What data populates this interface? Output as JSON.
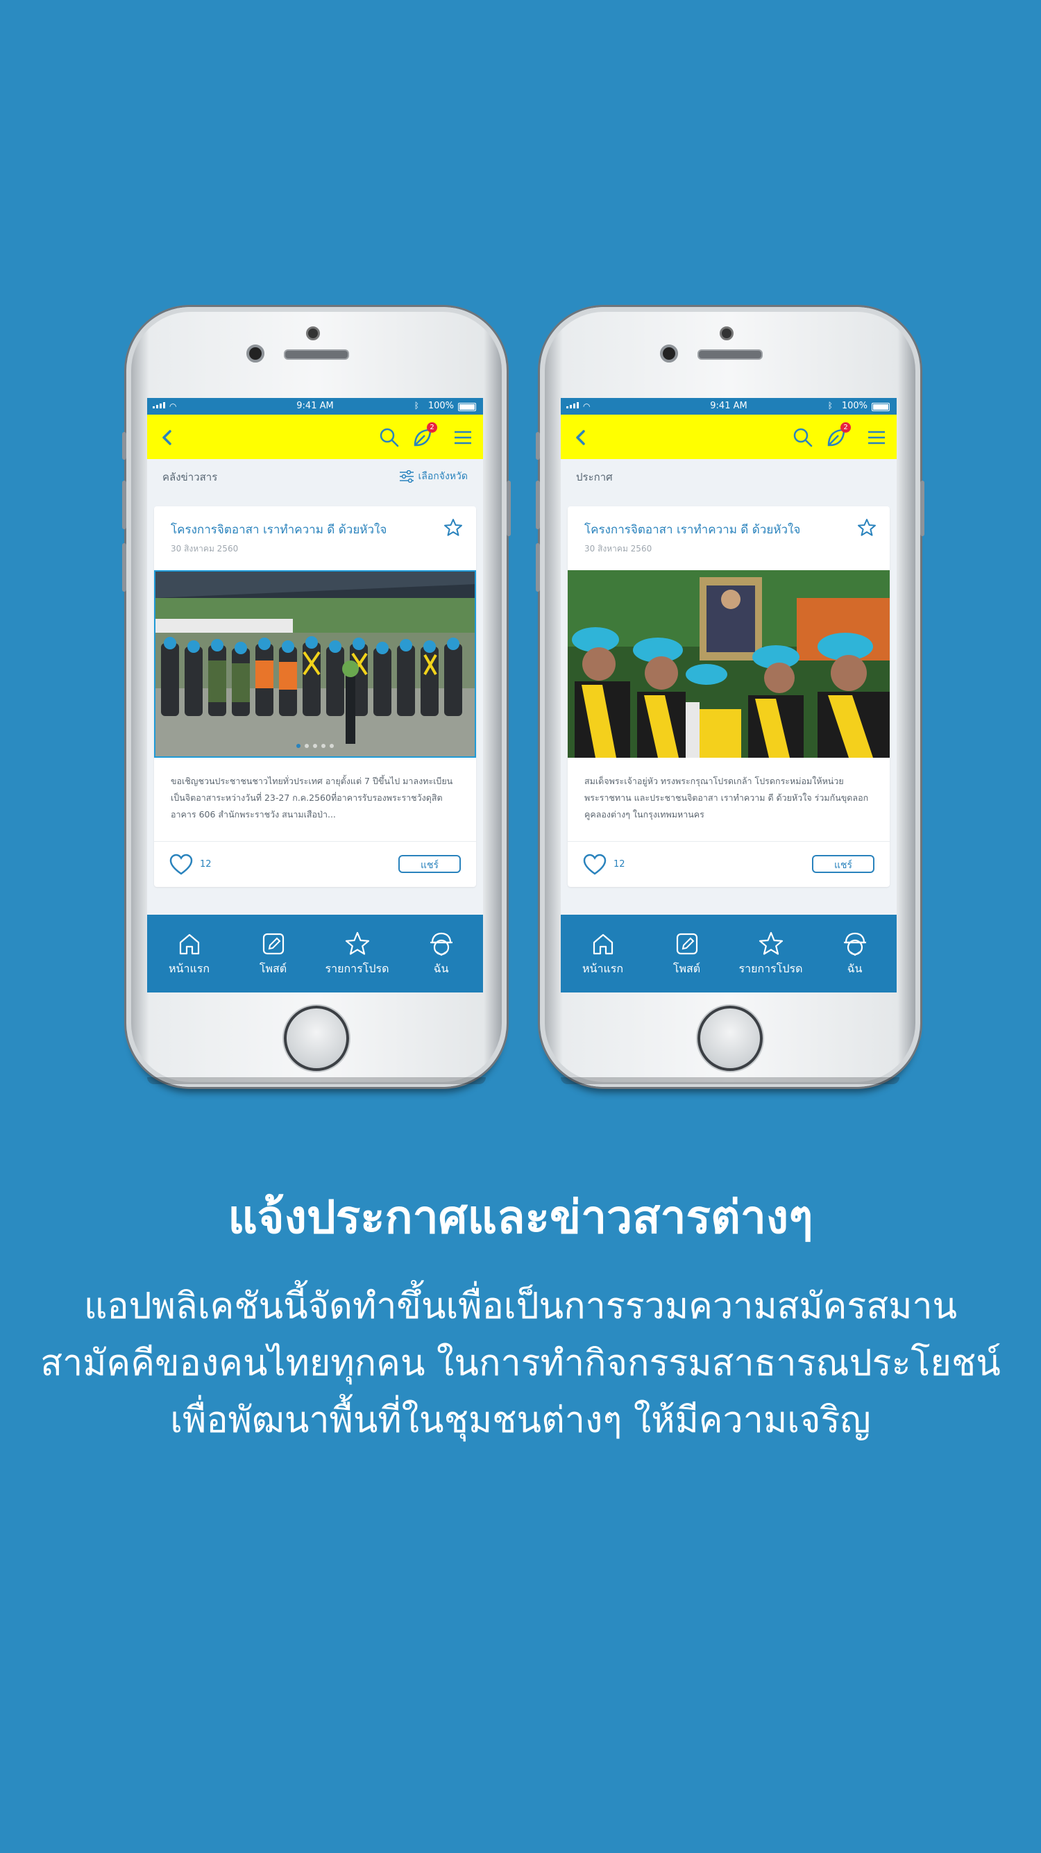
{
  "status": {
    "time": "9:41 AM",
    "battery": "100%"
  },
  "phones": [
    {
      "section_label": "คลังข่าวสาร",
      "filter_label": "เลือกจังหวัด",
      "notification_count": "2",
      "card": {
        "title": "โครงการจิตอาสา เราทำความ ดี ด้วยหัวใจ",
        "date": "30 สิงหาคม 2560",
        "body": "ขอเชิญชวนประชาชนชาวไทยทั่วประเทศ อายุตั้งแต่ 7 ปีขึ้นไป มาลงทะเบียนเป็นจิตอาสาระหว่างวันที่ 23-27 ก.ค.2560ที่อาคารรับรองพระราชวังดุสิต อาคาร 606 สำนักพระราชวัง สนามเสือป่า...",
        "likes": "12",
        "share": "แชร์"
      }
    },
    {
      "section_label": "ประกาศ",
      "filter_label": "",
      "notification_count": "2",
      "card": {
        "title": "โครงการจิตอาสา เราทำความ ดี ด้วยหัวใจ",
        "date": "30 สิงหาคม 2560",
        "body": "สมเด็จพระเจ้าอยู่หัว ทรงพระกรุณาโปรดเกล้า โปรดกระหม่อมให้หน่วยพระราชทาน และประชาชนจิตอาสา เราทำความ ดี ด้วยหัวใจ ร่วมกันขุดลอกคูคลองต่างๆ ในกรุงเทพมหานคร",
        "likes": "12",
        "share": "แชร์"
      }
    }
  ],
  "bottom_nav": [
    {
      "label": "หน้าแรก",
      "icon": "home-icon"
    },
    {
      "label": "โพสต์",
      "icon": "edit-icon"
    },
    {
      "label": "รายการโปรด",
      "icon": "star-icon"
    },
    {
      "label": "ฉัน",
      "icon": "volunteer-avatar-icon"
    }
  ],
  "headline": "แจ้งประกาศและข่าวสารต่างๆ",
  "description": [
    "แอปพลิเคชันนี้จัดทำขึ้นเพื่อเป็นการรวมความสมัครสมาน",
    "สามัคคีของคนไทยทุกคน ในการทำกิจกรรมสาธารณประโยชน์",
    "เพื่อพัฒนาพื้นที่ในชุมชนต่างๆ ให้มีความเจริญ"
  ],
  "colors": {
    "background": "#2b8bc1",
    "toolbar": "#ffff00",
    "primary": "#1f7fb8",
    "badge": "#e8233d"
  }
}
